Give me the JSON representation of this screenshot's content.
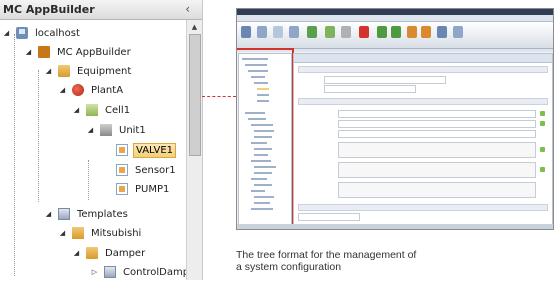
{
  "panel": {
    "title": "MC AppBuilder",
    "collapse_glyph": "‹",
    "collapse_icon": "chevron-left-icon"
  },
  "tree": {
    "expanded_glyph": "◢",
    "collapsed_glyph": "▷",
    "items": [
      {
        "label": "localhost",
        "icon": "server-icon",
        "expanded": true
      },
      {
        "label": "MC AppBuilder",
        "icon": "app-icon",
        "expanded": true
      },
      {
        "label": "Equipment",
        "icon": "folder-icon",
        "expanded": true
      },
      {
        "label": "PlantA",
        "icon": "plant-icon",
        "expanded": true
      },
      {
        "label": "Cell1",
        "icon": "cell-icon",
        "expanded": true
      },
      {
        "label": "Unit1",
        "icon": "unit-icon",
        "expanded": true
      },
      {
        "label": "VALVE1",
        "icon": "device-icon",
        "selected": true
      },
      {
        "label": "Sensor1",
        "icon": "device-icon"
      },
      {
        "label": "PUMP1",
        "icon": "device-icon"
      },
      {
        "label": "Templates",
        "icon": "templates-icon",
        "expanded": true
      },
      {
        "label": "Mitsubishi",
        "icon": "folder-icon",
        "expanded": true
      },
      {
        "label": "Damper",
        "icon": "folder-icon",
        "expanded": true
      },
      {
        "label": "ControlDamper",
        "icon": "template-icon"
      }
    ]
  },
  "caption": {
    "line1": "The tree format for the management of",
    "line2": "a system configuration"
  },
  "colors": {
    "highlight": "#d6322c",
    "selection": "#f3cf77"
  }
}
